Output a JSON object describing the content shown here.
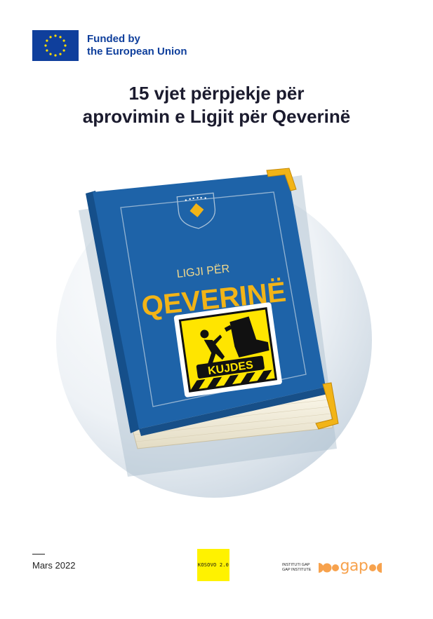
{
  "header": {
    "eu_line1": "Funded by",
    "eu_line2": "the European Union"
  },
  "title": {
    "line1": "15 vjet përpjekje për",
    "line2": "aprovimin e Ligjit për Qeverinë"
  },
  "book": {
    "subtitle": "LIGJI PËR",
    "main": "QEVERINË",
    "sign_label": "KUJDES"
  },
  "footer": {
    "date": "Mars 2022",
    "kosovo_logo": "KOSOVO 2.0",
    "gap_line1": "Instituti GAP",
    "gap_line2": "GAP Institute",
    "gap_word": "gap"
  },
  "colors": {
    "eu_blue": "#0f3f9c",
    "book_blue": "#1e63a8",
    "gold": "#f2b417",
    "warning_yellow": "#ffe500",
    "gap_orange": "#f7a24d",
    "kosovo_yellow": "#fff200"
  }
}
